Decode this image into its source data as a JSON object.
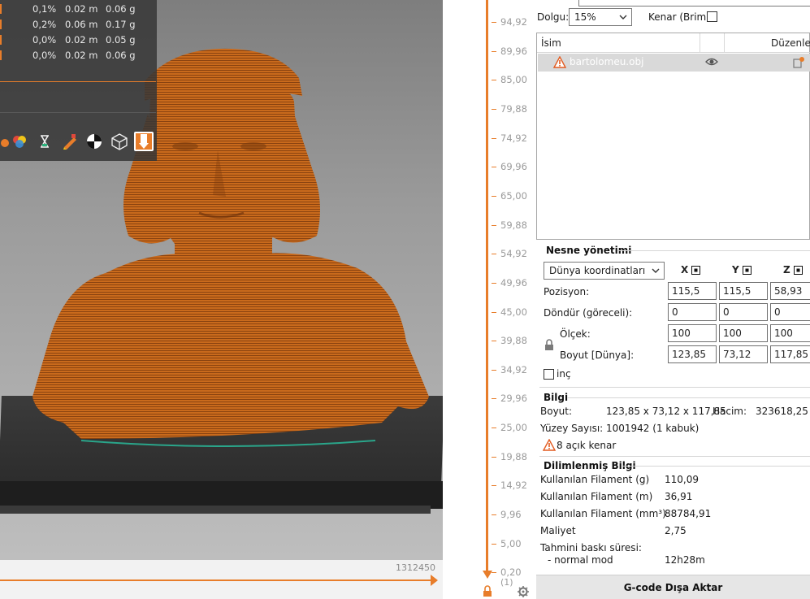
{
  "viewport": {
    "layer_count": "1312450",
    "legend_rows": [
      {
        "percent": "0,1%",
        "length": "0.02 m",
        "weight": "0.06 g"
      },
      {
        "percent": "0,2%",
        "length": "0.06 m",
        "weight": "0.17 g"
      },
      {
        "percent": "0,0%",
        "length": "0.02 m",
        "weight": "0.05 g"
      },
      {
        "percent": "0,0%",
        "length": "0.02 m",
        "weight": "0.06 g"
      }
    ],
    "tools": [
      "color-print-icon",
      "hourglass-icon",
      "feature-type-icon",
      "fan-speed-icon",
      "wireframe-icon",
      "extruder-icon"
    ],
    "colors": {
      "model": "#c86a1a",
      "accent": "#e87d2a",
      "bed": "#2e2e2e"
    }
  },
  "vertical_slider": {
    "ticks": [
      "94,92",
      "89,96",
      "85,00",
      "79,88",
      "74,92",
      "69,96",
      "65,00",
      "59,88",
      "54,92",
      "49,96",
      "45,00",
      "39,88",
      "34,92",
      "29,96",
      "25,00",
      "19,88",
      "14,92",
      "9,96",
      "5,00",
      "0,20"
    ],
    "bottom_label": "(1)"
  },
  "panel": {
    "infill_label": "Dolgu:",
    "infill_value": "15%",
    "brim_label": "Kenar (Brim):",
    "list": {
      "col_name": "İsim",
      "col_edit": "Düzenlen",
      "item_name": "bartolomeu.obj"
    },
    "object_mgmt": {
      "title": "Nesne yönetimi",
      "coord_select": "Dünya koordinatları",
      "axes": [
        "X",
        "Y",
        "Z"
      ],
      "position_label": "Pozisyon:",
      "position": [
        "115,5",
        "115,5",
        "58,93"
      ],
      "rotate_label": "Döndür (göreceli):",
      "rotate": [
        "0",
        "0",
        "0"
      ],
      "scale_label": "Ölçek:",
      "scale": [
        "100",
        "100",
        "100"
      ],
      "size_label": "Boyut [Dünya]:",
      "size": [
        "123,85",
        "73,12",
        "117,85"
      ],
      "inch_label": "inç"
    },
    "info": {
      "title": "Bilgi",
      "size_label": "Boyut:",
      "size_value": "123,85 x 73,12 x 117,85",
      "volume_label": "Hacim:",
      "volume_value": "323618,25",
      "facets_label": "Yüzey Sayısı:",
      "facets_value": "1001942 (1 kabuk)",
      "warning": "8 açık kenar"
    },
    "sliced": {
      "title": "Dilimlenmiş Bilgi",
      "rows": [
        {
          "label": "Kullanılan Filament (g)",
          "value": "110,09"
        },
        {
          "label": "Kullanılan Filament (m)",
          "value": "36,91"
        },
        {
          "label": "Kullanılan Filament (mm³)",
          "value": "88784,91"
        },
        {
          "label": "Maliyet",
          "value": "2,75"
        }
      ],
      "time_label": "Tahmini baskı süresi:",
      "mode_label": "- normal mod",
      "mode_value": "12h28m"
    },
    "export_label": "G-code Dışa Aktar"
  }
}
